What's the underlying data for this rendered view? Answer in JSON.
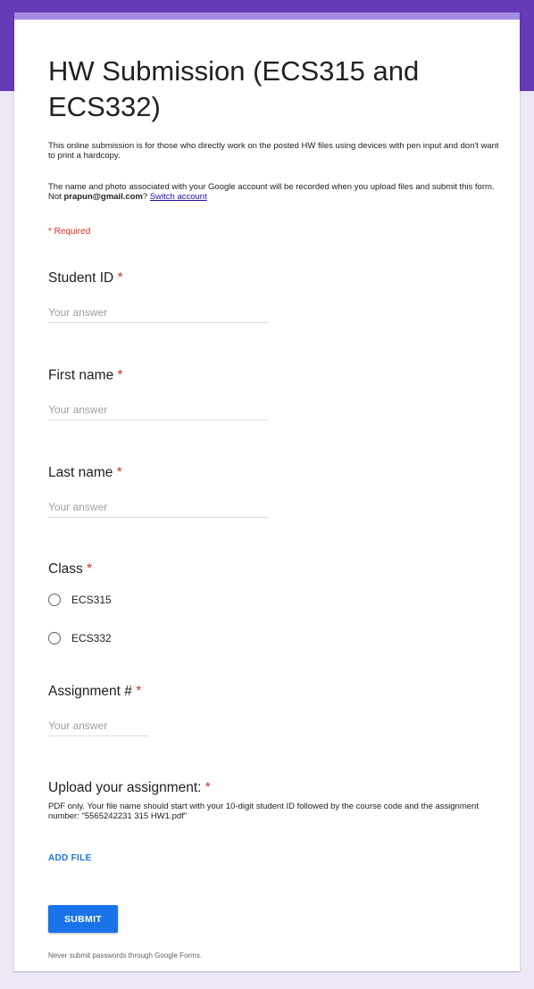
{
  "form": {
    "title": "HW Submission (ECS315 and ECS332)",
    "description_1": "This online submission is for those who directly work on the posted HW files using devices with pen input and don't want to print a hardcopy.",
    "description_2_prefix": "The name and photo associated with your Google account will be recorded when you upload files and submit this form. Not ",
    "account_email": "prapun@gmail.com",
    "description_2_suffix": "?",
    "switch_account_label": "Switch account",
    "required_note": "* Required"
  },
  "questions": {
    "student_id": {
      "label": "Student ID",
      "star": "*",
      "placeholder": "Your answer"
    },
    "first_name": {
      "label": "First name",
      "star": "*",
      "placeholder": "Your answer"
    },
    "last_name": {
      "label": "Last name",
      "star": "*",
      "placeholder": "Your answer"
    },
    "class": {
      "label": "Class",
      "star": "*",
      "options": [
        "ECS315",
        "ECS332"
      ]
    },
    "assignment": {
      "label": "Assignment #",
      "star": "*",
      "placeholder": "Your answer"
    },
    "upload": {
      "label": "Upload your assignment:",
      "star": "*",
      "help": "PDF only. Your file name should start with your 10-digit student ID followed by the course code and the assignment number: \"5565242231 315 HW1.pdf\"",
      "add_file_label": "ADD FILE"
    }
  },
  "actions": {
    "submit_label": "SUBMIT"
  },
  "footer": {
    "note": "Never submit passwords through Google Forms."
  },
  "colors": {
    "header": "#673ab7",
    "accent_top": "#a48ce5",
    "background": "#ede7f6",
    "required": "#d93025",
    "primary": "#1a73e8"
  }
}
